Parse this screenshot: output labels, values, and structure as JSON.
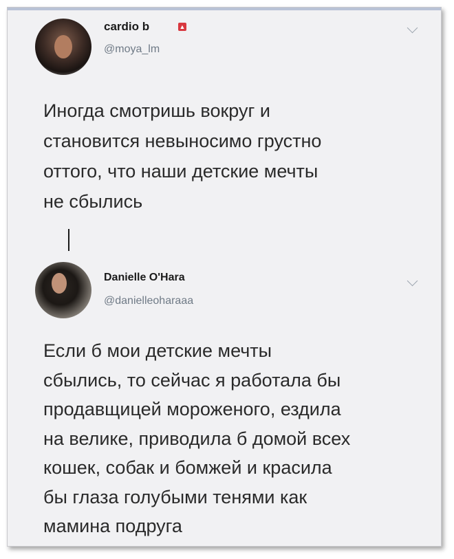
{
  "tweets": [
    {
      "name": "cardio b",
      "handle": "@moya_lm",
      "text": "Иногда смотришь вокруг и\nстановится невыносимо грустно\nоттого, что наши детские мечты\nне сбылись",
      "badge_color": "#d8383f",
      "icons": [
        "avatar",
        "badge-icon",
        "chevron-down-icon"
      ]
    },
    {
      "name": "Danielle O'Hara",
      "handle": "@danielleoharaaa",
      "text": "Если б мои детские мечты\nсбылись, то сейчас я работала бы\nпродавщицей мороженого, ездила\nна велике, приводила б домой всех\nкошек, собак и бомжей и красила\nбы глаза голубыми тенями как\nмамина подруга",
      "icons": [
        "avatar",
        "chevron-down-icon"
      ]
    }
  ],
  "colors": {
    "background": "#f1f1f3",
    "text": "#2a2a2a",
    "handle": "#6f7a86"
  }
}
